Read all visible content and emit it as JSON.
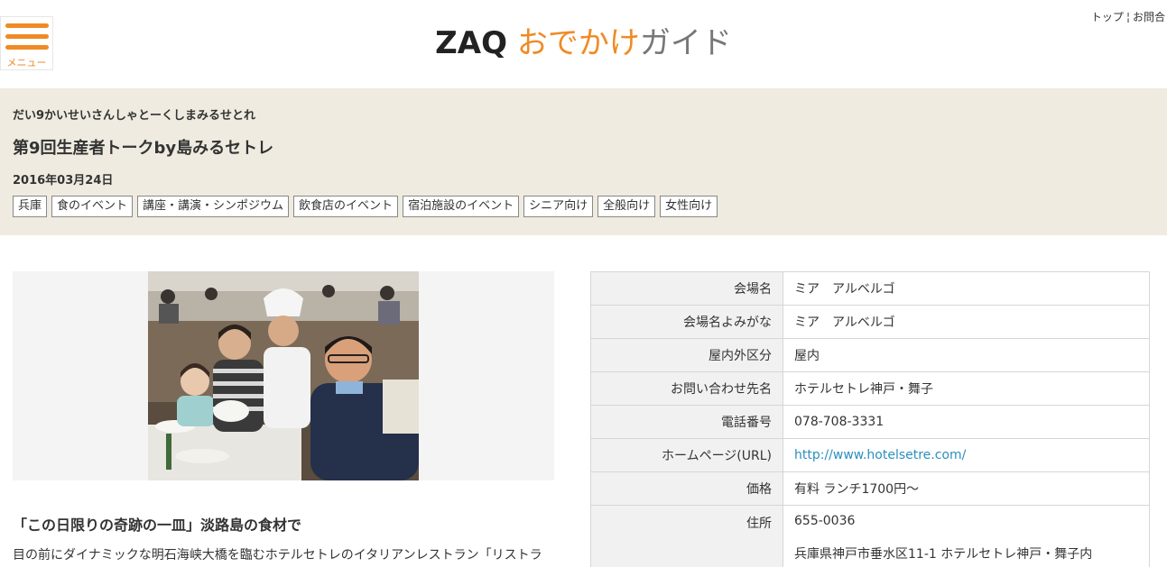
{
  "header": {
    "menu_label": "メニュー",
    "logo_zaq": "ZAQ",
    "logo_odekake": "おでかけ",
    "logo_guide": "ガイド",
    "top_links": [
      "トップ",
      "お問合"
    ],
    "colors": {
      "accent": "#f08a24",
      "logo_gray": "#777777"
    }
  },
  "event": {
    "reading": "だい9かいせいさんしゃとーくしまみるせとれ",
    "title": "第9回生産者トークby島みるセトレ",
    "date": "2016年03月24日",
    "tags": [
      "兵庫",
      "食のイベント",
      "講座・講演・シンポジウム",
      "飲食店のイベント",
      "宿泊施設のイベント",
      "シニア向け",
      "全般向け",
      "女性向け"
    ]
  },
  "article": {
    "heading": "「この日限りの奇跡の一皿」淡路島の食材で",
    "body": "目の前にダイナミックな明石海峡大橋を臨むホテルセトレのイタリアンレストラン「リストラ"
  },
  "info": {
    "rows": [
      {
        "label": "会場名",
        "value": "ミア　アルベルゴ"
      },
      {
        "label": "会場名よみがな",
        "value": "ミア　アルベルゴ"
      },
      {
        "label": "屋内外区分",
        "value": "屋内"
      },
      {
        "label": "お問い合わせ先名",
        "value": "ホテルセトレ神戸・舞子"
      },
      {
        "label": "電話番号",
        "value": "078-708-3331"
      },
      {
        "label": "ホームページ(URL)",
        "value": "http://www.hotelsetre.com/"
      },
      {
        "label": "価格",
        "value": "有料 ランチ1700円〜"
      },
      {
        "label": "住所",
        "value": "655-0036",
        "value2": "兵庫県神戸市垂水区11-1 ホテルセトレ神戸・舞子内"
      }
    ]
  }
}
